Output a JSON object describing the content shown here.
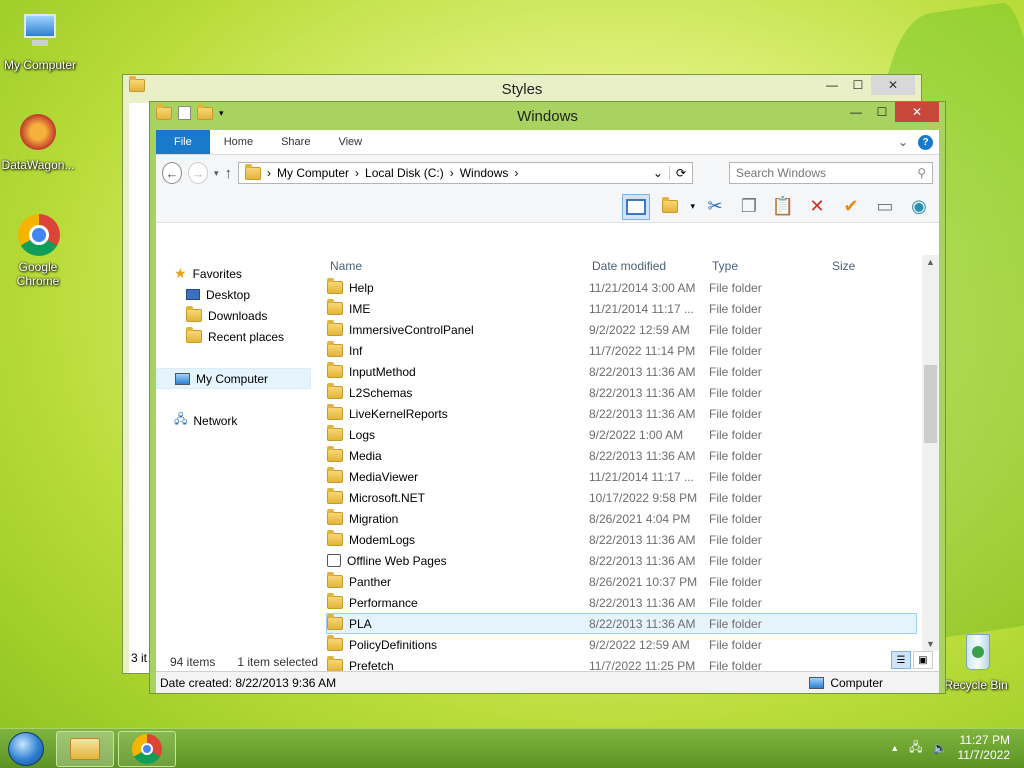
{
  "desktop": {
    "icons": [
      {
        "label": "My Computer"
      },
      {
        "label": "DataWagon..."
      },
      {
        "label": "Google Chrome"
      },
      {
        "label": "Recycle Bin"
      }
    ]
  },
  "background_window": {
    "title": "Styles",
    "status_partial": "3 it"
  },
  "window": {
    "title": "Windows",
    "controls": {
      "minimize": "—",
      "maximize": "☐",
      "close": "✕"
    },
    "ribbon_tabs": [
      {
        "label": "File"
      },
      {
        "label": "Home"
      },
      {
        "label": "Share"
      },
      {
        "label": "View"
      }
    ],
    "address": {
      "crumbs": [
        "My Computer",
        "Local Disk (C:)",
        "Windows"
      ]
    },
    "search": {
      "placeholder": "Search Windows"
    },
    "nav": {
      "favorites": "Favorites",
      "desktop": "Desktop",
      "downloads": "Downloads",
      "recent": "Recent places",
      "computer": "My Computer",
      "network": "Network"
    },
    "columns": {
      "name": "Name",
      "date": "Date modified",
      "type": "Type",
      "size": "Size"
    },
    "files": [
      {
        "name": "Help",
        "date": "11/21/2014 3:00 AM",
        "type": "File folder"
      },
      {
        "name": "IME",
        "date": "11/21/2014 11:17 ...",
        "type": "File folder"
      },
      {
        "name": "ImmersiveControlPanel",
        "date": "9/2/2022 12:59 AM",
        "type": "File folder"
      },
      {
        "name": "Inf",
        "date": "11/7/2022 11:14 PM",
        "type": "File folder"
      },
      {
        "name": "InputMethod",
        "date": "8/22/2013 11:36 AM",
        "type": "File folder"
      },
      {
        "name": "L2Schemas",
        "date": "8/22/2013 11:36 AM",
        "type": "File folder"
      },
      {
        "name": "LiveKernelReports",
        "date": "8/22/2013 11:36 AM",
        "type": "File folder"
      },
      {
        "name": "Logs",
        "date": "9/2/2022 1:00 AM",
        "type": "File folder"
      },
      {
        "name": "Media",
        "date": "8/22/2013 11:36 AM",
        "type": "File folder"
      },
      {
        "name": "MediaViewer",
        "date": "11/21/2014 11:17 ...",
        "type": "File folder"
      },
      {
        "name": "Microsoft.NET",
        "date": "10/17/2022 9:58 PM",
        "type": "File folder"
      },
      {
        "name": "Migration",
        "date": "8/26/2021 4:04 PM",
        "type": "File folder"
      },
      {
        "name": "ModemLogs",
        "date": "8/22/2013 11:36 AM",
        "type": "File folder"
      },
      {
        "name": "Offline Web Pages",
        "date": "8/22/2013 11:36 AM",
        "type": "File folder",
        "special": true
      },
      {
        "name": "Panther",
        "date": "8/26/2021 10:37 PM",
        "type": "File folder"
      },
      {
        "name": "Performance",
        "date": "8/22/2013 11:36 AM",
        "type": "File folder"
      },
      {
        "name": "PLA",
        "date": "8/22/2013 11:36 AM",
        "type": "File folder",
        "selected": true
      },
      {
        "name": "PolicyDefinitions",
        "date": "9/2/2022 12:59 AM",
        "type": "File folder"
      },
      {
        "name": "Prefetch",
        "date": "11/7/2022 11:25 PM",
        "type": "File folder"
      }
    ],
    "status": {
      "count": "94 items",
      "selection": "1 item selected"
    },
    "details": {
      "created": "Date created: 8/22/2013 9:36 AM",
      "location": "Computer"
    }
  },
  "taskbar": {
    "time": "11:27 PM",
    "date": "11/7/2022"
  }
}
